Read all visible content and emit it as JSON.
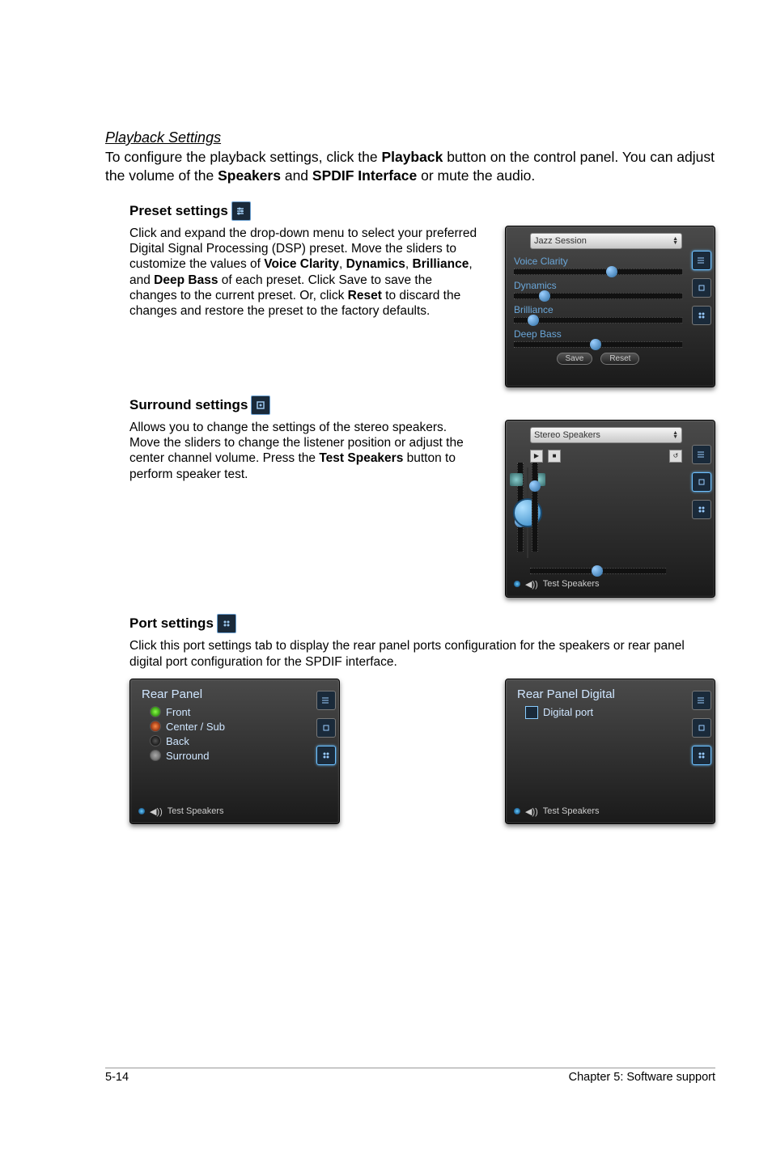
{
  "title": "Playback Settings",
  "intro_parts": {
    "a": "To configure the playback settings, click the ",
    "b": "Playback",
    "c": " button on the control panel. You can adjust the volume of the ",
    "d": "Speakers",
    "e": " and ",
    "f": "SPDIF Interface",
    "g": " or mute the audio."
  },
  "preset": {
    "heading": "Preset settings",
    "body_a": "Click and expand the drop-down menu to select your preferred Digital Signal Processing (DSP) preset. Move the sliders to customize the values of ",
    "b_voice": "Voice Clarity",
    "comma1": ", ",
    "b_dyn": "Dynamics",
    "comma2": ", ",
    "b_bril": "Brilliance",
    "comma3": ", and ",
    "b_bass": "Deep Bass",
    "body_b": " of each preset. Click Save to save the changes to the current preset. Or, click ",
    "b_reset": "Reset",
    "body_c": " to discard the changes and restore the preset to the factory defaults."
  },
  "preset_panel": {
    "dropdown": "Jazz Session",
    "sliders": [
      "Voice Clarity",
      "Dynamics",
      "Brilliance",
      "Deep Bass"
    ],
    "save": "Save",
    "reset": "Reset"
  },
  "surround": {
    "heading": "Surround settings",
    "body_a": "Allows you to change the settings of the stereo speakers. Move the sliders to change the listener position or adjust the center channel volume. Press the ",
    "b_test": "Test Speakers",
    "body_b": " button to perform speaker test."
  },
  "surround_panel": {
    "dropdown": "Stereo Speakers",
    "test": "Test Speakers"
  },
  "port": {
    "heading": "Port settings",
    "body": "Click this port settings tab to display the rear panel ports configuration for the speakers or rear panel digital port configuration for the SPDIF interface."
  },
  "port_panel_left": {
    "title": "Rear Panel",
    "items": [
      "Front",
      "Center / Sub",
      "Back",
      "Surround"
    ],
    "test": "Test Speakers"
  },
  "port_panel_right": {
    "title": "Rear Panel Digital",
    "item": "Digital port",
    "test": "Test Speakers"
  },
  "footer": {
    "left": "5-14",
    "right": "Chapter 5: Software support"
  }
}
